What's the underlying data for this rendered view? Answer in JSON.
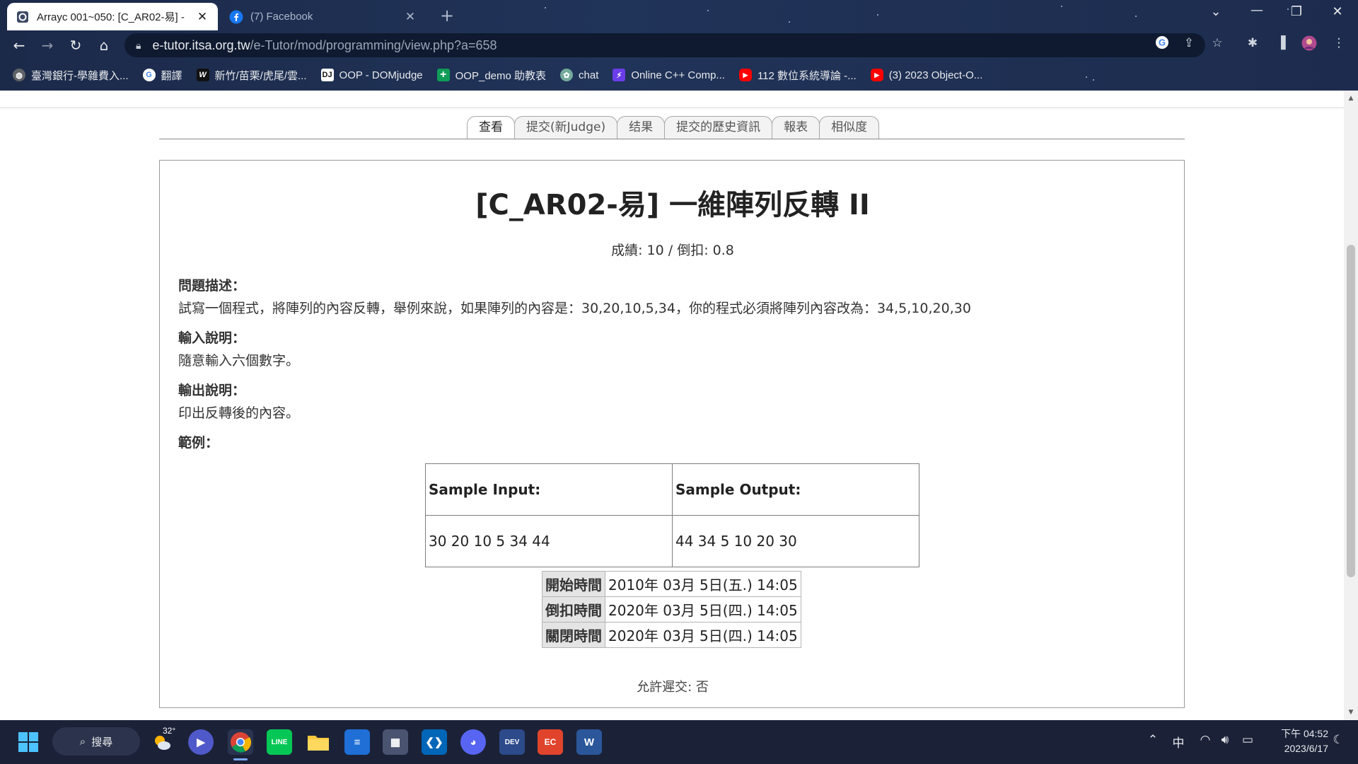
{
  "browser": {
    "tabs": [
      {
        "title": "Arrayc 001~050: [C_AR02-易] -",
        "active": true
      },
      {
        "title": "(7) Facebook",
        "active": false
      }
    ],
    "new_tab": "+",
    "window_controls": {
      "dropdown": "⌄",
      "minimize": "—",
      "restore": "❐",
      "close": "✕"
    },
    "url_host": "e-tutor.itsa.org.tw",
    "url_path": "/e-Tutor/mod/programming/view.php?a=658",
    "bookmarks": [
      {
        "label": "臺灣銀行-學雜費入...",
        "icon": "globe-icon",
        "color": "#5f6368"
      },
      {
        "label": "翻譯",
        "icon": "google-icon",
        "color": "#ffffff"
      },
      {
        "label": "新竹/苗栗/虎尾/雲...",
        "icon": "w-logo-icon",
        "color": "#111111"
      },
      {
        "label": "OOP - DOMjudge",
        "icon": "domjudge-icon",
        "color": "#ffffff"
      },
      {
        "label": "OOP_demo 助教表",
        "icon": "sheets-plus-icon",
        "color": "#0f9d58"
      },
      {
        "label": "chat",
        "icon": "chatgpt-icon",
        "color": "#74aa9c"
      },
      {
        "label": "Online C++ Comp...",
        "icon": "bolt-icon",
        "color": "#6a3de8"
      },
      {
        "label": "112 數位系統導論 -...",
        "icon": "youtube-icon",
        "color": "#ff0000"
      },
      {
        "label": "(3) 2023 Object-O...",
        "icon": "youtube-icon",
        "color": "#ff0000"
      }
    ]
  },
  "page": {
    "tabs": [
      "查看",
      "提交(新Judge)",
      "结果",
      "提交的歷史資訊",
      "報表",
      "相似度"
    ],
    "active_tab": "查看",
    "title": "[C_AR02-易] 一維陣列反轉 II",
    "score_line": "成績: 10 / 倒扣: 0.8",
    "description": {
      "heading": "問題描述：",
      "text": "試寫一個程式，將陣列的內容反轉，舉例來說，如果陣列的內容是：30,20,10,5,34，你的程式必須將陣列內容改為：34,5,10,20,30"
    },
    "input": {
      "heading": "輸入說明：",
      "text": "隨意輸入六個數字。"
    },
    "output": {
      "heading": "輸出說明：",
      "text": "印出反轉後的內容。"
    },
    "example": {
      "heading": "範例："
    },
    "sample": {
      "input_header": "Sample Input:",
      "output_header": "Sample Output:",
      "input_value": "30 20 10 5 34 44",
      "output_value": "44 34 5 10 20 30"
    },
    "times": [
      {
        "label": "開始時間",
        "value": "2010年 03月 5日(五.) 14:05"
      },
      {
        "label": "倒扣時間",
        "value": "2020年 03月 5日(四.) 14:05"
      },
      {
        "label": "關閉時間",
        "value": "2020年 03月 5日(四.) 14:05"
      }
    ],
    "late_submission": "允許遲交: 否"
  },
  "taskbar": {
    "search_label": "搜尋",
    "weather_temp": "32°",
    "input_method": "中",
    "clock_time": "下午 04:52",
    "clock_date": "2023/6/17",
    "apps": [
      "start",
      "weather",
      "meet",
      "chrome",
      "line",
      "file-explorer",
      "notepad",
      "calculator",
      "vscode",
      "discord",
      "dev-cpp",
      "recorder",
      "word"
    ]
  }
}
